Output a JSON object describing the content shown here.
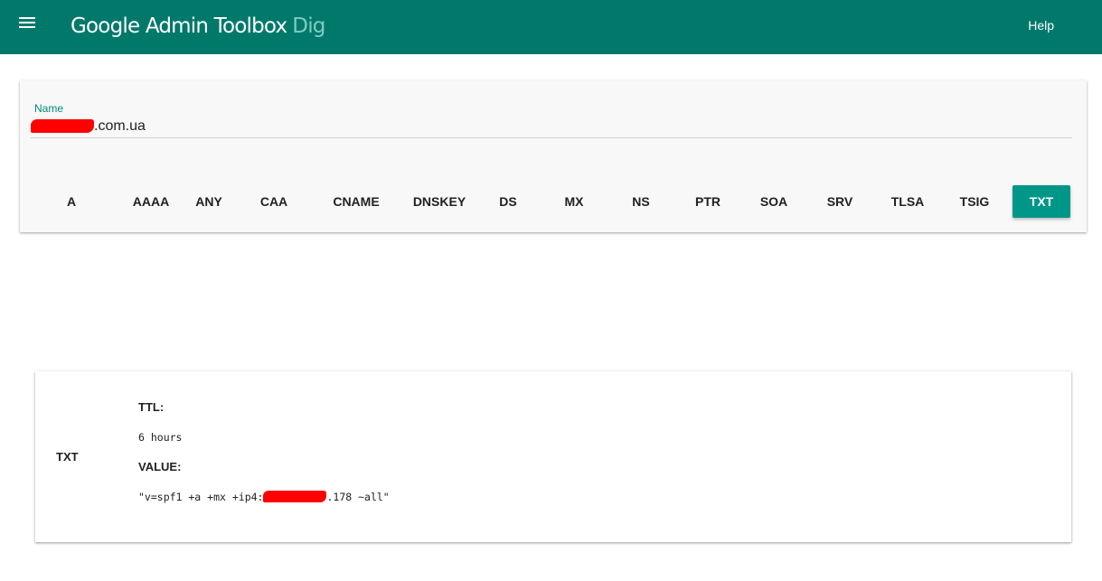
{
  "header": {
    "menu_icon": "hamburger-menu-icon",
    "title": "Google Admin Toolbox",
    "subtitle": "Dig",
    "help_label": "Help",
    "colors": {
      "bar": "#00796b",
      "subtitle": "#80cbc4"
    }
  },
  "query": {
    "name_label": "Name",
    "name_value_visible": ".com.ua",
    "record_types": [
      {
        "label": "A",
        "active": false
      },
      {
        "label": "AAAA",
        "active": false
      },
      {
        "label": "ANY",
        "active": false
      },
      {
        "label": "CAA",
        "active": false
      },
      {
        "label": "CNAME",
        "active": false
      },
      {
        "label": "DNSKEY",
        "active": false
      },
      {
        "label": "DS",
        "active": false
      },
      {
        "label": "MX",
        "active": false
      },
      {
        "label": "NS",
        "active": false
      },
      {
        "label": "PTR",
        "active": false
      },
      {
        "label": "SOA",
        "active": false
      },
      {
        "label": "SRV",
        "active": false
      },
      {
        "label": "TLSA",
        "active": false
      },
      {
        "label": "TSIG",
        "active": false
      },
      {
        "label": "TXT",
        "active": true
      }
    ],
    "active_color": "#009688"
  },
  "result": {
    "type": "TXT",
    "ttl_label": "TTL:",
    "ttl_value": "6 hours",
    "value_label": "VALUE:",
    "value_prefix": "\"v=spf1 +a +mx +ip4:",
    "value_suffix": ".178 ~all\""
  }
}
